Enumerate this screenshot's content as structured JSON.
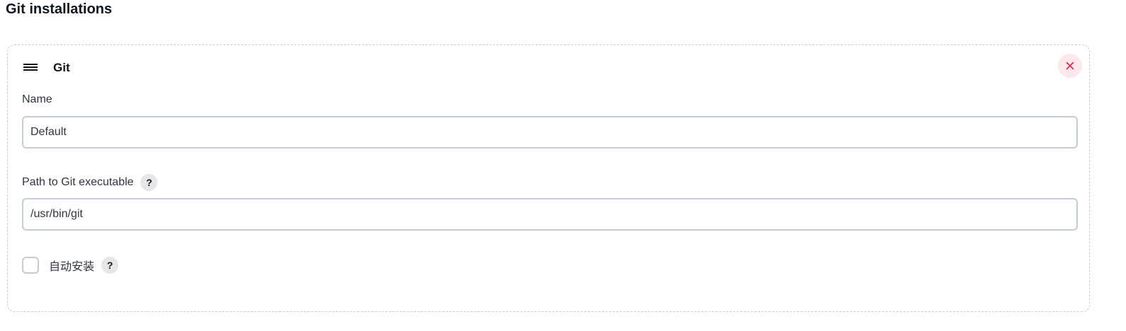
{
  "section": {
    "title": "Git installations"
  },
  "installation": {
    "title": "Git",
    "drag_icon": "drag-handle-icon",
    "delete_icon": "close-icon",
    "name_field": {
      "label": "Name",
      "value": "Default"
    },
    "path_field": {
      "label": "Path to Git executable",
      "value": "/usr/bin/git",
      "help": "?"
    },
    "auto_install": {
      "label": "自动安装",
      "checked": false,
      "help": "?"
    }
  },
  "colors": {
    "delete_accent": "#e0224e",
    "delete_bg": "#fbe8ec",
    "border": "#c5cbd3"
  }
}
